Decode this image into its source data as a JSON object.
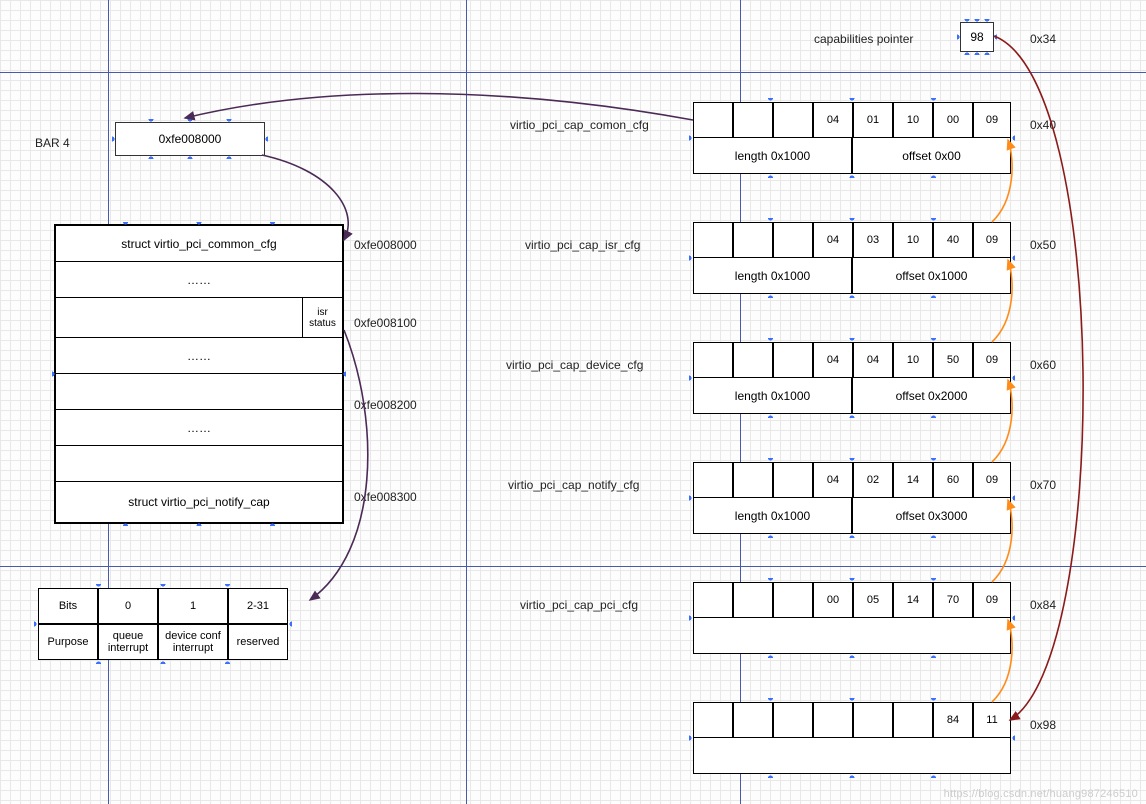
{
  "caps_pointer": {
    "label": "capabilities pointer",
    "value": "98",
    "addr": "0x34"
  },
  "bar4": {
    "label": "BAR 4",
    "value": "0xfe008000"
  },
  "mem": {
    "title_top": "struct virtio_pci_common_cfg",
    "addr_top": "0xfe008000",
    "row_dots": "……",
    "isr_label": "isr\nstatus",
    "addr_isr": "0xfe008100",
    "addr_mid": "0xfe008200",
    "title_notify": "struct virtio_pci_notify_cap",
    "addr_notify": "0xfe008300"
  },
  "bits": {
    "h0": "Bits",
    "h1": "0",
    "h2": "1",
    "h3": "2-31",
    "r0": "Purpose",
    "r1": "queue interrupt",
    "r2": "device conf interrupt",
    "r3": "reserved"
  },
  "caps": [
    {
      "name": "virtio_pci_cap_comon_cfg",
      "cells": [
        "",
        "",
        "",
        "04",
        "01",
        "10",
        "00",
        "09"
      ],
      "length": "length 0x1000",
      "offset": "offset 0x00",
      "addr": "0x40"
    },
    {
      "name": "virtio_pci_cap_isr_cfg",
      "cells": [
        "",
        "",
        "",
        "04",
        "03",
        "10",
        "40",
        "09"
      ],
      "length": "length 0x1000",
      "offset": "offset 0x1000",
      "addr": "0x50"
    },
    {
      "name": "virtio_pci_cap_device_cfg",
      "cells": [
        "",
        "",
        "",
        "04",
        "04",
        "10",
        "50",
        "09"
      ],
      "length": "length 0x1000",
      "offset": "offset 0x2000",
      "addr": "0x60"
    },
    {
      "name": "virtio_pci_cap_notify_cfg",
      "cells": [
        "",
        "",
        "",
        "04",
        "02",
        "14",
        "60",
        "09"
      ],
      "length": "length 0x1000",
      "offset": "offset 0x3000",
      "addr": "0x70"
    },
    {
      "name": "virtio_pci_cap_pci_cfg",
      "cells": [
        "",
        "",
        "",
        "00",
        "05",
        "14",
        "70",
        "09"
      ],
      "length": "",
      "offset": "",
      "addr": "0x84"
    }
  ],
  "tail": {
    "cells": [
      "",
      "",
      "",
      "",
      "",
      "",
      "84",
      "11"
    ],
    "addr": "0x98"
  },
  "watermark": "https://blog.csdn.net/huang987246510"
}
